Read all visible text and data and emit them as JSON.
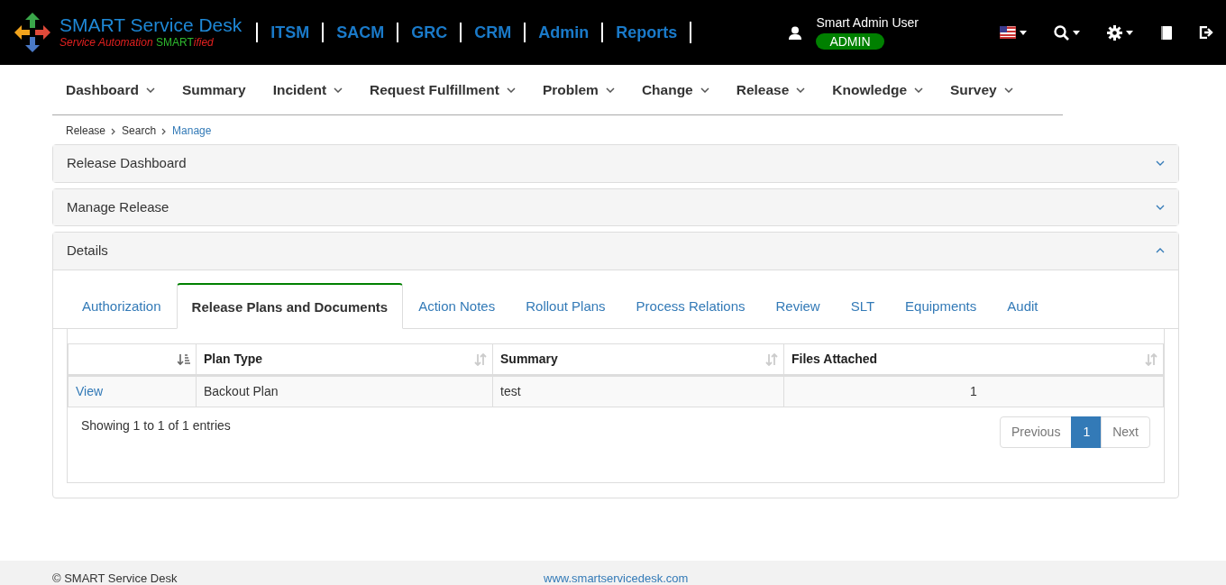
{
  "header": {
    "brand": "SMART Service Desk",
    "tagline_start": "Service Automation ",
    "tagline_mid": "SMART",
    "tagline_end": "ified",
    "modules": [
      "ITSM",
      "SACM",
      "GRC",
      "CRM",
      "Admin",
      "Reports"
    ],
    "user": {
      "name": "Smart Admin User",
      "role": "ADMIN"
    }
  },
  "menu": [
    {
      "label": "Dashboard",
      "dropdown": true
    },
    {
      "label": "Summary",
      "dropdown": false
    },
    {
      "label": "Incident",
      "dropdown": true
    },
    {
      "label": "Request Fulfillment",
      "dropdown": true
    },
    {
      "label": "Problem",
      "dropdown": true
    },
    {
      "label": "Change",
      "dropdown": true
    },
    {
      "label": "Release",
      "dropdown": true
    },
    {
      "label": "Knowledge",
      "dropdown": true
    },
    {
      "label": "Survey",
      "dropdown": true
    }
  ],
  "breadcrumb": [
    {
      "label": "Release",
      "selected": false
    },
    {
      "label": "Search",
      "selected": false
    },
    {
      "label": "Manage",
      "selected": true
    }
  ],
  "panels": [
    {
      "title": "Release Dashboard",
      "expanded": false
    },
    {
      "title": "Manage Release",
      "expanded": false
    },
    {
      "title": "Details",
      "expanded": true
    }
  ],
  "tabs": [
    {
      "label": "Authorization",
      "selected": false
    },
    {
      "label": "Release Plans and Documents",
      "selected": true
    },
    {
      "label": "Action Notes",
      "selected": false
    },
    {
      "label": "Rollout Plans",
      "selected": false
    },
    {
      "label": "Process Relations",
      "selected": false
    },
    {
      "label": "Review",
      "selected": false
    },
    {
      "label": "SLT",
      "selected": false
    },
    {
      "label": "Equipments",
      "selected": false
    },
    {
      "label": "Audit",
      "selected": false
    }
  ],
  "table": {
    "columns": [
      {
        "sorted": true
      },
      {
        "label": "Plan Type",
        "sorted": false
      },
      {
        "label": "Summary",
        "sorted": false
      },
      {
        "label": "Files Attached",
        "sorted": false
      }
    ],
    "rows": [
      {
        "action": "View",
        "plan_type": "Backout Plan",
        "summary": "test",
        "files_attached": "1"
      }
    ],
    "info": "Showing 1 to 1 of 1 entries",
    "pagination": [
      {
        "label": "Previous",
        "selected": false
      },
      {
        "label": "1",
        "selected": true
      },
      {
        "label": "Next",
        "selected": false
      }
    ]
  },
  "footer": {
    "copyright": "© SMART Service Desk",
    "link": "www.smartservicedesk.com"
  }
}
